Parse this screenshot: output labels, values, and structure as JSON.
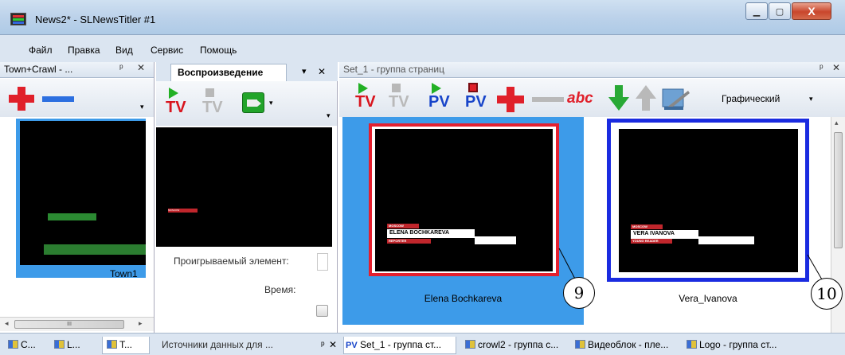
{
  "window": {
    "title": "News2* - SLNewsTitler #1",
    "min_label": "▁",
    "max_label": "▢",
    "close_label": "X"
  },
  "menu": [
    "Файл",
    "Правка",
    "Вид",
    "Сервис",
    "Помощь"
  ],
  "left_panel": {
    "title": "Town+Crawl - ...",
    "pin": "ᵖ",
    "close": "✕",
    "item_label": "Town1",
    "hscroll_thumb": "III"
  },
  "mid_panel": {
    "tab_label": "Воспроизведение",
    "close": "✕",
    "menu_arrow": "▾",
    "tv_label": "TV",
    "tv2_label": "TV",
    "field_label": "Проигрываемый элемент:",
    "time_label": "Время:"
  },
  "right_panel": {
    "title": "Set_1 - группа страниц",
    "pin": "ᵖ",
    "close": "✕",
    "toolbar": {
      "tv_label": "TV",
      "tv2_label": "TV",
      "pv_label": "PV",
      "pv2_label": "PV",
      "abc_label": "abc",
      "view_label": "Графический"
    },
    "cards": [
      {
        "name": "Elena Bochkareva",
        "lt_name": "ELENA BOCHKAREVA",
        "lt_sub": "REPORTER",
        "callout": "9"
      },
      {
        "name": "Vera_Ivanova",
        "lt_name": "VERA IVANOVA",
        "lt_sub": "YOUNG READER",
        "callout": "10"
      }
    ],
    "lt_top": "MOSCOW"
  },
  "mid_tag": "MOSCOW",
  "bottom_tabs": {
    "left": [
      "C...",
      "L...",
      "T..."
    ],
    "mid": "Источники данных для ...",
    "right": [
      "Set_1 - группа ст...",
      "crowl2 - группа с...",
      "Видеоблок - пле...",
      "Logo - группа ст..."
    ],
    "pv_prefix": "PV"
  },
  "colors": {
    "selection": "#3d9be9",
    "frame1": "#e4202f",
    "frame2": "#1a2be0",
    "tv_red": "#d8141d",
    "pv_blue": "#1744c9"
  }
}
